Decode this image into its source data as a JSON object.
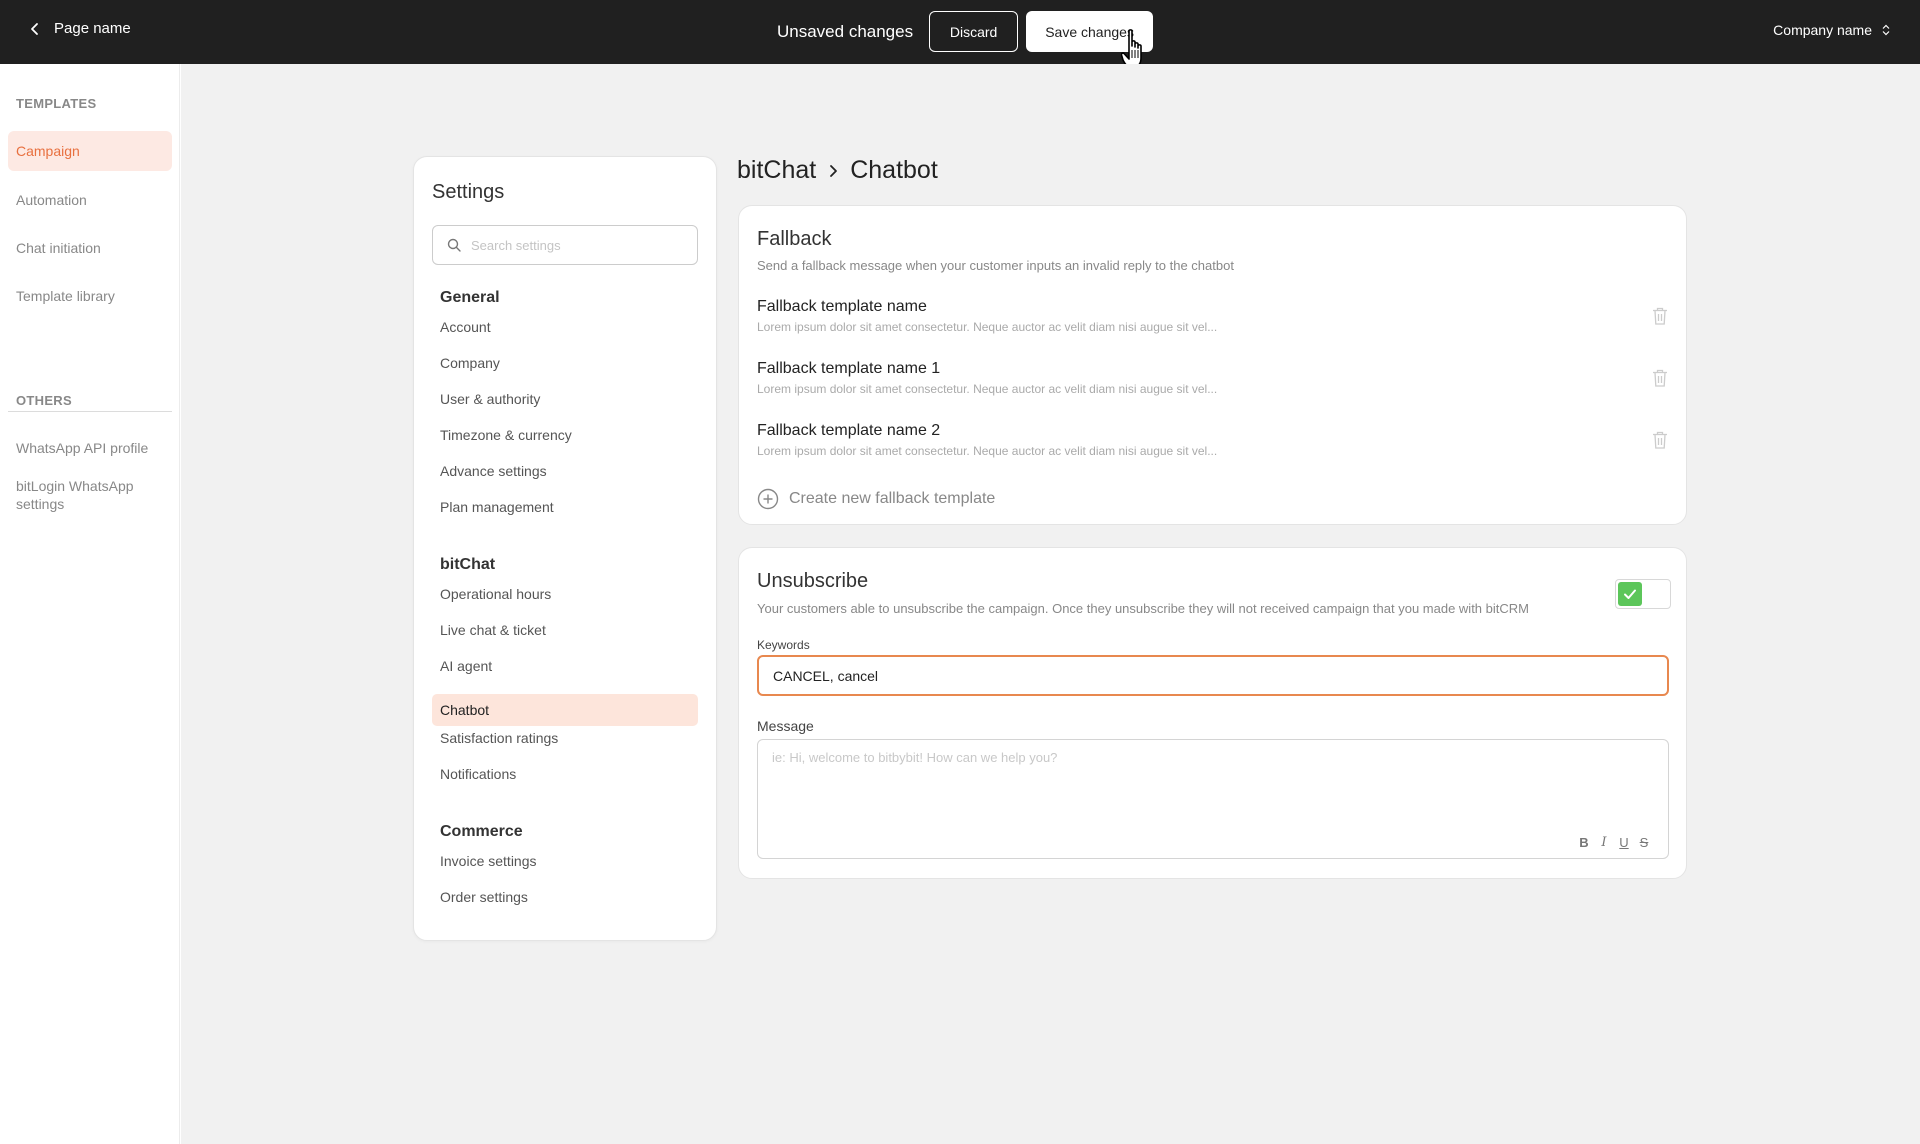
{
  "topbar": {
    "page_name": "Page name",
    "unsaved_text": "Unsaved changes",
    "discard_label": "Discard",
    "save_label": "Save changes",
    "company_name": "Company name"
  },
  "sidebar": {
    "templates_heading": "TEMPLATES",
    "templates": [
      "Campaign",
      "Automation",
      "Chat initiation",
      "Template library"
    ],
    "others_heading": "OTHERS",
    "others": [
      "WhatsApp API profile",
      "bitLogin WhatsApp settings"
    ]
  },
  "settings": {
    "title": "Settings",
    "search_placeholder": "Search settings",
    "general_heading": "General",
    "general_items": [
      "Account",
      "Company",
      "User & authority",
      "Timezone & currency",
      "Advance settings",
      "Plan management"
    ],
    "bitchat_heading": "bitChat",
    "bitchat_items": [
      "Operational hours",
      "Live chat & ticket",
      "AI agent",
      "Chatbot",
      "Satisfaction ratings",
      "Notifications"
    ],
    "commerce_heading": "Commerce",
    "commerce_items": [
      "Invoice settings",
      "Order settings"
    ]
  },
  "breadcrumb": {
    "parent": "bitChat",
    "current": "Chatbot"
  },
  "fallback": {
    "title": "Fallback",
    "description": "Send a fallback message when your customer inputs an invalid reply to the chatbot",
    "templates": [
      {
        "name": "Fallback template name",
        "desc": "Lorem ipsum dolor sit amet consectetur. Neque auctor ac velit diam nisi augue sit vel..."
      },
      {
        "name": "Fallback template name 1",
        "desc": "Lorem ipsum dolor sit amet consectetur. Neque auctor ac velit diam nisi augue sit vel..."
      },
      {
        "name": "Fallback template name 2",
        "desc": "Lorem ipsum dolor sit amet consectetur. Neque auctor ac velit diam nisi augue sit vel..."
      }
    ],
    "create_label": "Create new fallback template"
  },
  "unsubscribe": {
    "title": "Unsubscribe",
    "description": "Your customers able to unsubscribe the campaign. Once they unsubscribe they will not received campaign that you made with bitCRM",
    "toggle_on": true,
    "keywords_label": "Keywords",
    "keywords_value": "CANCEL, cancel",
    "message_label": "Message",
    "message_placeholder": "ie: Hi, welcome to bitbybit! How can we help you?",
    "format_buttons": [
      "B",
      "I",
      "U",
      "S"
    ]
  },
  "colors": {
    "accent": "#e8703f",
    "active_bg": "#fde9e3",
    "toggle_green": "#5cc65a",
    "topbar_bg": "#202020"
  }
}
